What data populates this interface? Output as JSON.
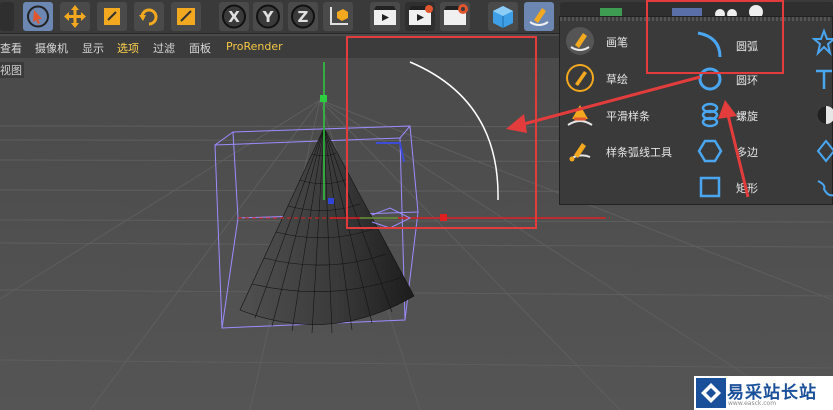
{
  "menu": {
    "items": [
      "查看",
      "摄像机",
      "显示",
      "选项",
      "过滤",
      "面板"
    ],
    "items_display": [
      "查看",
      "摄像机",
      "显示",
      "选项",
      "过滤",
      "面板"
    ],
    "first_visible": "查看",
    "active": "选项",
    "prorender": "ProRender"
  },
  "viewport": {
    "label": "视图"
  },
  "spline_menu": {
    "col1": [
      {
        "label": "画笔",
        "icon": "pen-icon"
      },
      {
        "label": "草绘",
        "icon": "sketch-icon"
      },
      {
        "label": "平滑样条",
        "icon": "smooth-spline-icon"
      },
      {
        "label": "样条弧线工具",
        "icon": "spline-arc-tool-icon"
      }
    ],
    "col2": [
      {
        "label": "圆弧",
        "icon": "arc-icon"
      },
      {
        "label": "圆环",
        "icon": "circle-icon"
      },
      {
        "label": "螺旋",
        "icon": "helix-icon"
      },
      {
        "label": "多边",
        "icon": "polygon-icon"
      },
      {
        "label": "矩形",
        "icon": "rectangle-icon"
      }
    ]
  },
  "toolbar": {
    "icons": [
      "select-arrow-icon",
      "move-icon",
      "scale-icon",
      "rotate-icon",
      "last-tool-icon",
      "x-axis-icon",
      "y-axis-icon",
      "z-axis-icon",
      "coordinate-system-icon",
      "render-view-icon",
      "render-picture-queue-icon",
      "render-settings-icon",
      "cube-icon",
      "pen-spline-icon"
    ],
    "axis_labels": [
      "X",
      "Y",
      "Z"
    ]
  },
  "watermark": {
    "text": "易采站长站",
    "sub": "www.easck.com"
  },
  "colors": {
    "highlight": "#e23c3c",
    "menu_active": "#ffd34d",
    "bbox": "#9b8cff",
    "y_axis": "#2ecc40",
    "x_axis": "#e02020"
  }
}
